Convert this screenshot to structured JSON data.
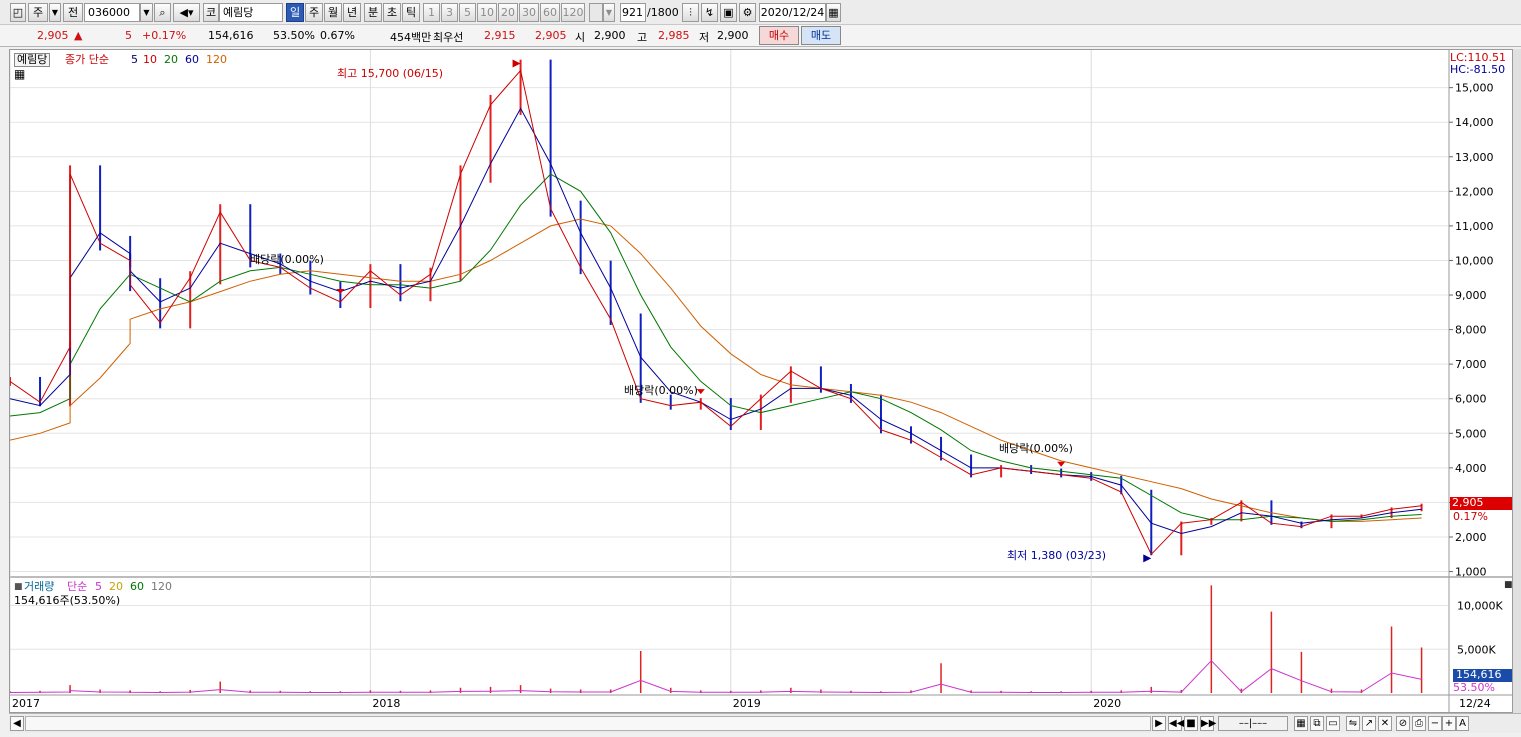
{
  "toolbar": {
    "market_label": "주",
    "prev_label": "전",
    "stock_code": "036000",
    "sector_code": "코",
    "stock_name": "예림당",
    "periods": [
      "일",
      "주",
      "월",
      "년",
      "분",
      "초",
      "틱"
    ],
    "active_period": "일",
    "intervals": [
      "1",
      "3",
      "5",
      "10",
      "20",
      "30",
      "60",
      "120"
    ],
    "count": "921",
    "count_total": "/1800",
    "date": "2020/12/24"
  },
  "quote": {
    "price": "2,905",
    "change_arrow": "▲",
    "change": "5",
    "change_pct": "+0.17%",
    "volume": "154,616",
    "volume_ratio": "53.50%",
    "turnover_pct": "0.67%",
    "value_label": "454백만",
    "best_label": "최우선",
    "best_ask": "2,915",
    "best_bid": "2,905",
    "open_label": "시",
    "open": "2,900",
    "high_label": "고",
    "high": "2,985",
    "low_label": "저",
    "low": "2,900",
    "buy_label": "매수",
    "sell_label": "매도"
  },
  "chart_data": [
    {
      "type": "line",
      "name": "price",
      "title": "예림당",
      "legend_prefix": "종가 단순",
      "ma_periods": [
        "5",
        "10",
        "20",
        "60",
        "120"
      ],
      "colors": {
        "up": "#e02020",
        "down": "#1020c0",
        "ma5": "#000066",
        "ma10": "#cc0000",
        "ma20": "#007700",
        "ma60": "#000099",
        "ma120": "#d06000"
      },
      "x_labels": [
        "2017",
        "2018",
        "2019",
        "2020",
        "12/24"
      ],
      "y_ticks": [
        "15,000",
        "14,000",
        "13,000",
        "12,000",
        "11,000",
        "10,000",
        "9,000",
        "8,000",
        "7,000",
        "6,000",
        "5,000",
        "4,000",
        "3,000",
        "2,000",
        "1,000"
      ],
      "ylim": [
        900,
        15800
      ],
      "lc_label": "LC:110.51",
      "hc_label": "HC:-81.50",
      "last_price": "2,905",
      "last_change": "0.17%",
      "annotations": {
        "high": "최고 15,700 (06/15)",
        "low": "최저 1,380 (03/23)",
        "dividends": [
          "배당락(0.00%)",
          "배당락(0.00%)",
          "배당락(0.00%)"
        ]
      },
      "x_points": [
        "2017-01",
        "2017-02",
        "2017-03",
        "2017-03",
        "2017-04",
        "2017-05",
        "2017-05",
        "2017-06",
        "2017-07",
        "2017-08",
        "2017-09",
        "2017-10",
        "2017-11",
        "2017-12",
        "2018-01",
        "2018-02",
        "2018-03",
        "2018-04",
        "2018-05",
        "2018-06",
        "2018-07",
        "2018-08",
        "2018-09",
        "2018-10",
        "2018-11",
        "2018-12",
        "2019-01",
        "2019-02",
        "2019-03",
        "2019-04",
        "2019-05",
        "2019-06",
        "2019-07",
        "2019-08",
        "2019-09",
        "2019-10",
        "2019-11",
        "2019-12",
        "2020-01",
        "2020-02",
        "2020-03",
        "2020-04",
        "2020-05",
        "2020-06",
        "2020-07",
        "2020-08",
        "2020-09",
        "2020-10",
        "2020-11",
        "2020-12"
      ],
      "close": [
        6500,
        5900,
        7500,
        12500,
        10500,
        10000,
        9300,
        8200,
        9500,
        11400,
        10000,
        9800,
        9200,
        8800,
        9700,
        9000,
        9600,
        12500,
        14500,
        15500,
        11500,
        9800,
        8300,
        6000,
        5800,
        5900,
        5200,
        6000,
        6800,
        6300,
        6000,
        5100,
        4800,
        4300,
        3800,
        4000,
        3900,
        3800,
        3700,
        3300,
        1500,
        2400,
        2500,
        3000,
        2400,
        2300,
        2600,
        2600,
        2800,
        2905
      ],
      "ma20": [
        6000,
        5800,
        6700,
        9500,
        10800,
        10200,
        9700,
        8800,
        9200,
        10500,
        10200,
        9900,
        9400,
        9100,
        9400,
        9200,
        9400,
        11000,
        12800,
        14400,
        12800,
        10800,
        9200,
        7200,
        6200,
        5900,
        5400,
        5700,
        6300,
        6300,
        6100,
        5400,
        5000,
        4500,
        4000,
        4000,
        3900,
        3800,
        3750,
        3500,
        2400,
        2100,
        2300,
        2700,
        2600,
        2400,
        2500,
        2550,
        2700,
        2800
      ],
      "ma60": [
        5500,
        5600,
        6000,
        7000,
        8600,
        9600,
        9600,
        9200,
        8800,
        9400,
        9700,
        9800,
        9600,
        9400,
        9300,
        9300,
        9200,
        9400,
        10300,
        11600,
        12500,
        12000,
        10800,
        9000,
        7500,
        6500,
        5800,
        5600,
        5800,
        6000,
        6200,
        6000,
        5600,
        5100,
        4500,
        4200,
        4000,
        3900,
        3800,
        3700,
        3200,
        2700,
        2500,
        2500,
        2600,
        2550,
        2450,
        2500,
        2600,
        2650
      ],
      "ma120": [
        4800,
        5000,
        5300,
        5800,
        6600,
        7600,
        8300,
        8600,
        8800,
        9100,
        9400,
        9600,
        9700,
        9600,
        9500,
        9400,
        9400,
        9600,
        10000,
        10500,
        11000,
        11200,
        11000,
        10200,
        9200,
        8100,
        7300,
        6700,
        6400,
        6300,
        6200,
        6100,
        5900,
        5600,
        5200,
        4800,
        4500,
        4200,
        4000,
        3800,
        3600,
        3400,
        3100,
        2900,
        2700,
        2550,
        2450,
        2450,
        2500,
        2550
      ]
    },
    {
      "type": "bar",
      "name": "volume",
      "legend": "거래량",
      "legend_prefix": "단순",
      "ma_periods": [
        "5",
        "20",
        "60",
        "120"
      ],
      "last_label": "154,616주(53.50%)",
      "y_ticks": [
        "10,000K",
        "5,000K"
      ],
      "ylim": [
        0,
        12000
      ],
      "last_value_label": "154,616",
      "last_ratio_label": "53.50%",
      "x_points": [
        "2017-01",
        "2017-02",
        "2017-03",
        "2017-03",
        "2017-04",
        "2017-05",
        "2017-05",
        "2017-06",
        "2017-07",
        "2017-08",
        "2017-09",
        "2017-10",
        "2017-11",
        "2017-12",
        "2018-01",
        "2018-02",
        "2018-03",
        "2018-04",
        "2018-05",
        "2018-06",
        "2018-07",
        "2018-08",
        "2018-09",
        "2018-10",
        "2018-11",
        "2018-12",
        "2019-01",
        "2019-02",
        "2019-03",
        "2019-04",
        "2019-05",
        "2019-06",
        "2019-07",
        "2019-08",
        "2019-09",
        "2019-10",
        "2019-11",
        "2019-12",
        "2020-01",
        "2020-02",
        "2020-03",
        "2020-04",
        "2020-05",
        "2020-06",
        "2020-07",
        "2020-08",
        "2020-09",
        "2020-10",
        "2020-11",
        "2020-12"
      ],
      "values": [
        200,
        250,
        400,
        900,
        400,
        300,
        250,
        200,
        350,
        1300,
        300,
        250,
        200,
        200,
        300,
        250,
        300,
        600,
        700,
        900,
        500,
        400,
        400,
        4800,
        600,
        300,
        250,
        300,
        600,
        400,
        250,
        200,
        300,
        3400,
        300,
        250,
        200,
        200,
        250,
        300,
        700,
        350,
        12300,
        500,
        9300,
        4700,
        500,
        400,
        7600,
        5200
      ]
    }
  ]
}
